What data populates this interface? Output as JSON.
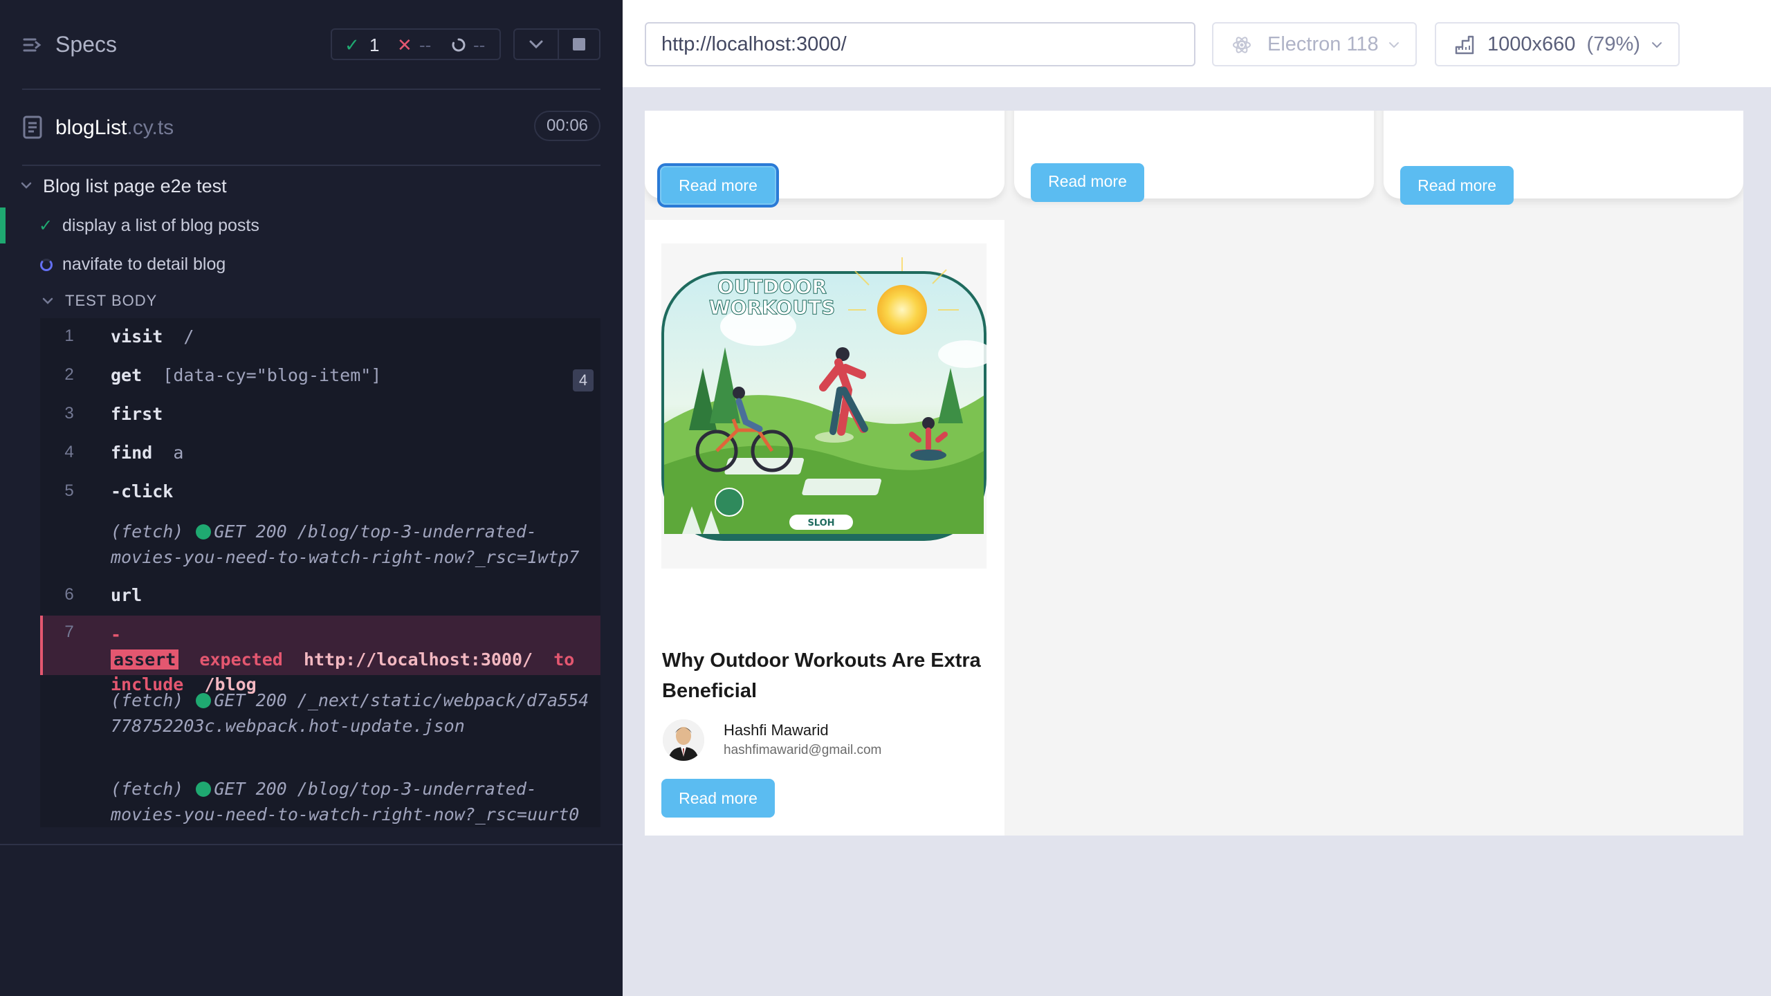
{
  "reporter": {
    "title": "Specs",
    "stats": {
      "passed": "1",
      "failed": "--",
      "pending": "--"
    },
    "file": {
      "name": "blogList",
      "ext": ".cy.ts",
      "duration": "00:06"
    },
    "suite": "Blog list page e2e test",
    "tests": [
      {
        "label": "display a list of blog posts",
        "state": "passed"
      },
      {
        "label": "navifate to detail blog",
        "state": "running"
      }
    ],
    "test_body_label": "TEST BODY",
    "commands": [
      {
        "num": "1",
        "name": "visit",
        "arg": "/"
      },
      {
        "num": "2",
        "name": "get",
        "arg": "[data-cy=\"blog-item\"]",
        "badge": "4"
      },
      {
        "num": "3",
        "name": "first",
        "arg": ""
      },
      {
        "num": "4",
        "name": "find",
        "arg": "a"
      },
      {
        "num": "5",
        "name": "-click",
        "arg": ""
      },
      {
        "num": "6",
        "name": "url",
        "arg": ""
      },
      {
        "num": "7",
        "name": "-",
        "assert": "assert",
        "expected": "expected",
        "value": "http://localhost:3000/",
        "to": "to",
        "include": "include",
        "target": "/blog"
      }
    ],
    "fetches": [
      {
        "prefix": "(fetch)",
        "text": "GET 200 /blog/top-3-underrated-movies-you-need-to-watch-right-now?_rsc=1wtp7"
      },
      {
        "prefix": "(fetch)",
        "text": "GET 200 /_next/static/webpack/d7a554778752203c.webpack.hot-update.json"
      },
      {
        "prefix": "(fetch)",
        "text": "GET 200 /blog/top-3-underrated-movies-you-need-to-watch-right-now?_rsc=uurt0"
      }
    ]
  },
  "aut": {
    "url": "http://localhost:3000/",
    "browser": "Electron 118",
    "viewport": "1000x660",
    "scale": "(79%)",
    "read_more": "Read more",
    "post": {
      "title": "Why Outdoor Workouts Are Extra Beneficial",
      "author": "Hashfi Mawarid",
      "email": "hashfimawarid@gmail.com",
      "image_text": "OUTDOOR WORKOUTS",
      "image_badge": "SLOH"
    }
  },
  "colors": {
    "pass": "#1fa971",
    "fail": "#e45770",
    "accent": "#5bbcf1",
    "reporter_bg": "#1b1e2e"
  }
}
